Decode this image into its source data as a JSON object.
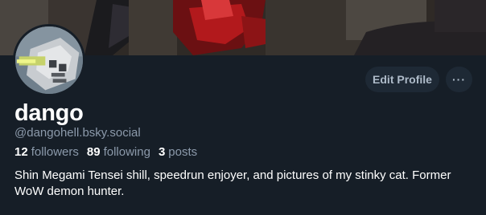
{
  "profile": {
    "display_name": "dango",
    "handle": "@dangohell.bsky.social",
    "bio": "Shin Megami Tensei shill, speedrun enjoyer, and pictures of my stinky cat. Former WoW demon hunter.",
    "stats": {
      "followers_count": "12",
      "followers_label": "followers",
      "following_count": "89",
      "following_label": "following",
      "posts_count": "3",
      "posts_label": "posts"
    }
  },
  "actions": {
    "edit_label": "Edit Profile",
    "more_label": "···"
  },
  "icons": {
    "more": "ellipsis-icon"
  },
  "colors": {
    "background": "#161e27",
    "button_bg": "#1e2935",
    "muted_text": "#8c9aab",
    "primary_text": "#ffffff"
  }
}
